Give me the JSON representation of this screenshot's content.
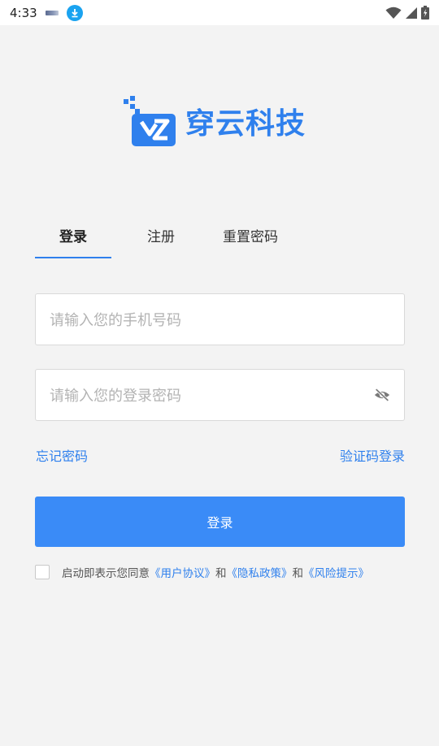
{
  "status_bar": {
    "time": "4:33"
  },
  "brand": {
    "name": "穿云科技",
    "color": "#2f80ed"
  },
  "tabs": [
    {
      "label": "登录",
      "active": true
    },
    {
      "label": "注册",
      "active": false
    },
    {
      "label": "重置密码",
      "active": false
    }
  ],
  "phone_input": {
    "placeholder": "请输入您的手机号码",
    "value": ""
  },
  "password_input": {
    "placeholder": "请输入您的登录密码",
    "value": "",
    "toggle_icon": "eye-off-icon"
  },
  "links": {
    "forgot_password": "忘记密码",
    "code_login": "验证码登录"
  },
  "login_button": {
    "label": "登录",
    "color": "#3a8bf7"
  },
  "agreement": {
    "checked": false,
    "prefix": "启动即表示您同意",
    "user_agreement": "《用户协议》",
    "and1": "和",
    "privacy_policy": "《隐私政策》",
    "and2": "和",
    "risk_notice": "《风险提示》"
  }
}
